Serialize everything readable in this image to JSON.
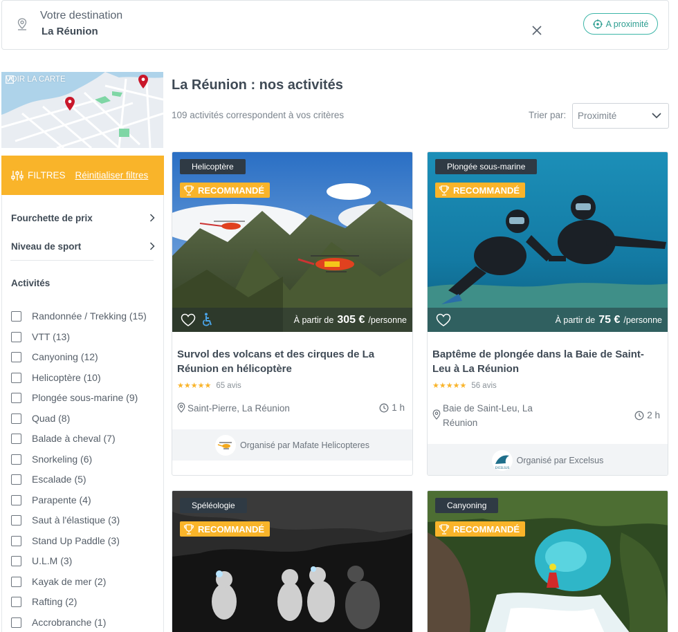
{
  "search": {
    "label": "Votre destination",
    "value": "La Réunion",
    "near_label": "A proximité"
  },
  "map": {
    "label": "VOIR LA CARTE"
  },
  "filters": {
    "title": "FILTRES",
    "reset": "Réinitialiser filtres",
    "price_range": "Fourchette de prix",
    "sport_level": "Niveau de sport",
    "activities_title": "Activités",
    "activities": [
      "Randonnée / Trekking (15)",
      "VTT (13)",
      "Canyoning (12)",
      "Helicoptère (10)",
      "Plongée sous-marine (9)",
      "Quad (8)",
      "Balade à cheval (7)",
      "Snorkeling (6)",
      "Escalade (5)",
      "Parapente (4)",
      "Saut à l'élastique (3)",
      "Stand Up Paddle (3)",
      "U.L.M (3)",
      "Kayak de mer (2)",
      "Rafting (2)",
      "Accrobranche (1)"
    ]
  },
  "main": {
    "title": "La Réunion : nos activités",
    "count": "109 activités correspondent à vos critères",
    "sort_label": "Trier par:",
    "sort_value": "Proximité"
  },
  "cards": [
    {
      "category": "Helicoptère",
      "badge": "RECOMMANDÉ",
      "price_prefix": "À partir de",
      "price": "305 €",
      "price_suffix": "/personne",
      "title": "Survol des volcans et des cirques de La Réunion en hélicoptère",
      "stars": "★★★★★",
      "reviews": "65 avis",
      "location": "Saint-Pierre, La Réunion",
      "duration": "1 h",
      "organizer": "Organisé par Mafate Helicopteres"
    },
    {
      "category": "Plongée sous-marine",
      "badge": "RECOMMANDÉ",
      "price_prefix": "À partir de",
      "price": "75 €",
      "price_suffix": "/personne",
      "title": "Baptême de plongée dans la Baie de Saint-Leu à La Réunion",
      "stars": "★★★★★",
      "reviews": "56 avis",
      "location": "Baie de Saint-Leu, La Réunion",
      "duration": "2 h",
      "organizer": "Organisé par Excelsus",
      "organizer_logo_text": "EXCELSUS"
    },
    {
      "category": "Spéléologie",
      "badge": "RECOMMANDÉ"
    },
    {
      "category": "Canyoning",
      "badge": "RECOMMANDÉ"
    }
  ],
  "colors": {
    "accent": "#f9b42a",
    "teal": "#3bb5a7",
    "dark_tag": "#2f3a44"
  }
}
